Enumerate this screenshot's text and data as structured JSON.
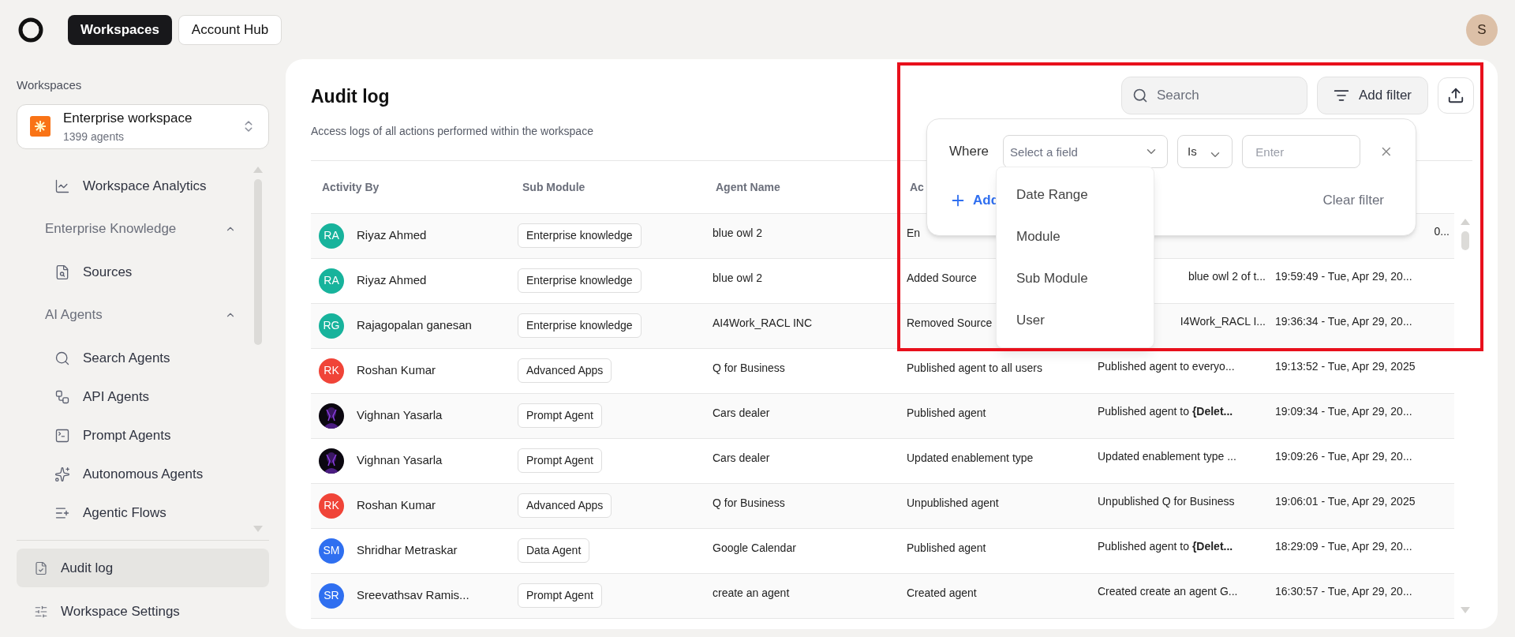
{
  "top_nav": {
    "tabs": [
      {
        "label": "Workspaces",
        "selected": true
      },
      {
        "label": "Account Hub",
        "selected": false
      }
    ],
    "user_initial": "S"
  },
  "sidebar": {
    "heading": "Workspaces",
    "workspace": {
      "name": "Enterprise workspace",
      "count": "1399 agents"
    },
    "items": [
      {
        "kind": "link",
        "label": "Workspace Analytics"
      },
      {
        "kind": "section",
        "label": "Enterprise Knowledge",
        "expanded": true,
        "children": [
          {
            "kind": "link",
            "label": "Sources"
          }
        ]
      },
      {
        "kind": "section",
        "label": "AI Agents",
        "expanded": true,
        "children": [
          {
            "kind": "link",
            "label": "Search Agents"
          },
          {
            "kind": "link",
            "label": "API Agents"
          },
          {
            "kind": "link",
            "label": "Prompt Agents"
          },
          {
            "kind": "link",
            "label": "Autonomous Agents"
          },
          {
            "kind": "link",
            "label": "Agentic Flows"
          }
        ]
      }
    ],
    "bottom_items": [
      {
        "label": "Audit log",
        "selected": true
      },
      {
        "label": "Workspace Settings",
        "selected": false
      }
    ]
  },
  "main": {
    "title": "Audit log",
    "subtitle": "Access logs of all actions performed within the workspace",
    "search": {
      "placeholder": "Search"
    },
    "add_filter": "Add filter",
    "filter_popover": {
      "where": "Where",
      "field": {
        "placeholder": "Select a field"
      },
      "operator": "Is",
      "value": {
        "placeholder": "Enter"
      },
      "add_label": "Add",
      "clear_label": "Clear filter",
      "options": [
        "Date Range",
        "Module",
        "Sub Module",
        "User"
      ]
    },
    "table": {
      "columns": [
        "Activity By",
        "Sub Module",
        "Agent Name",
        "Ac"
      ],
      "rows": [
        {
          "user": "Riyaz Ahmed",
          "avatar": {
            "kind": "initials",
            "initials": "RA",
            "color": "#17b39c"
          },
          "sub_module": "Enterprise knowledge",
          "agent": "blue owl 2",
          "action": "En",
          "time": "0...",
          "time_clipped": true
        },
        {
          "user": "Riyaz Ahmed",
          "avatar": {
            "kind": "initials",
            "initials": "RA",
            "color": "#17b39c"
          },
          "sub_module": "Enterprise knowledge",
          "agent": "blue owl 2",
          "action": "Added Source",
          "details": "blue owl 2 of t...",
          "details_clipped": true,
          "time": "19:59:49 - Tue, Apr 29, 20..."
        },
        {
          "user": "Rajagopalan ganesan",
          "avatar": {
            "kind": "initials",
            "initials": "RG",
            "color": "#17b39c"
          },
          "sub_module": "Enterprise knowledge",
          "agent": "AI4Work_RACL INC",
          "action": "Removed Source",
          "details": "I4Work_RACL I...",
          "details_clipped": true,
          "time": "19:36:34 - Tue, Apr 29, 20..."
        },
        {
          "user": "Roshan Kumar",
          "avatar": {
            "kind": "initials",
            "initials": "RK",
            "color": "#f04438"
          },
          "sub_module": "Advanced Apps",
          "agent": "Q for Business",
          "action": "Published agent to all users",
          "details": "Published agent to everyo...",
          "time": "19:13:52 - Tue, Apr 29, 2025"
        },
        {
          "user": "Vighnan Yasarla",
          "sub_module": "Prompt Agent",
          "agent": "Cars dealer",
          "action": "Published agent",
          "details": "Published agent to **{Delet...**",
          "time": "19:09:34 - Tue, Apr 29, 20..."
        },
        {
          "user": "Vighnan Yasarla",
          "sub_module": "Prompt Agent",
          "agent": "Cars dealer",
          "action": "Updated enablement type",
          "details": "Updated enablement type ...",
          "time": "19:09:26 - Tue, Apr 29, 20..."
        },
        {
          "user": "Roshan Kumar",
          "avatar": {
            "kind": "initials",
            "initials": "RK",
            "color": "#f04438"
          },
          "sub_module": "Advanced Apps",
          "agent": "Q for Business",
          "action": "Unpublished agent",
          "details": "Unpublished Q for Business",
          "time": "19:06:01 - Tue, Apr 29, 2025"
        },
        {
          "user": "Shridhar Metraskar",
          "avatar": {
            "kind": "initials",
            "initials": "SM",
            "color": "#2f6ff0"
          },
          "sub_module": "Data Agent",
          "agent": "Google Calendar",
          "action": "Published agent",
          "details": "Published agent to **{Delet...**",
          "time": "18:29:09 - Tue, Apr 29, 20..."
        },
        {
          "user": "Sreevathsav Ramis...",
          "avatar": {
            "kind": "initials",
            "initials": "SR",
            "color": "#2f6ff0"
          },
          "sub_module": "Prompt Agent",
          "agent": "create an agent",
          "action": "Created agent",
          "details": "Created create an agent G...",
          "time": "16:30:57 - Tue, Apr 29, 20..."
        }
      ]
    }
  }
}
